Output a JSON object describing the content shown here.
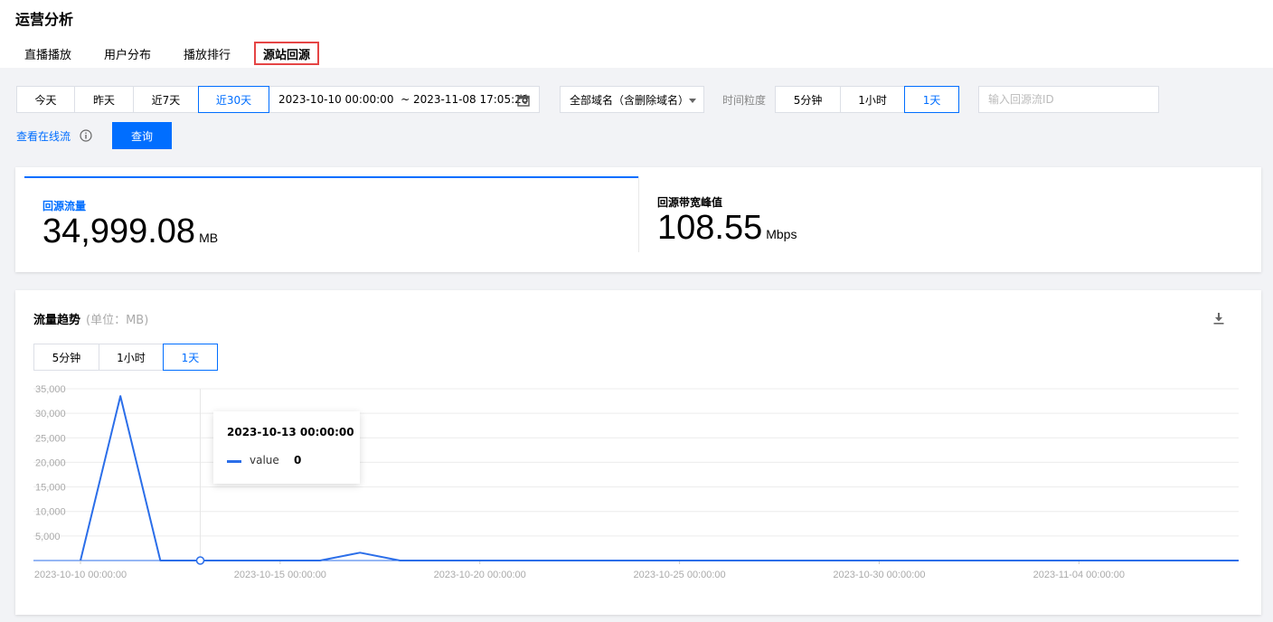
{
  "page": {
    "title": "运营分析",
    "tabs": [
      {
        "label": "直播播放"
      },
      {
        "label": "用户分布"
      },
      {
        "label": "播放排行"
      },
      {
        "label": "源站回源",
        "active": true
      }
    ]
  },
  "filters": {
    "date_presets": [
      {
        "label": "今天"
      },
      {
        "label": "昨天"
      },
      {
        "label": "近7天"
      },
      {
        "label": "近30天",
        "active": true
      }
    ],
    "date_range": "2023-10-10 00:00:00  ~ 2023-11-08 17:05:28",
    "domain_select": "全部域名（含删除域名）",
    "granularity_label": "时间粒度",
    "granularity": [
      {
        "label": "5分钟"
      },
      {
        "label": "1小时"
      },
      {
        "label": "1天",
        "active": true
      }
    ],
    "stream_id_placeholder": "输入回源流ID",
    "online_stream_link": "查看在线流",
    "query_button": "查询"
  },
  "stats": [
    {
      "label": "回源流量",
      "value": "34,999.08",
      "unit": "MB"
    },
    {
      "label": "回源带宽峰值",
      "value": "108.55",
      "unit": "Mbps"
    }
  ],
  "chart_panel": {
    "title": "流量趋势",
    "subtitle": "(单位：MB)",
    "granularity": [
      {
        "label": "5分钟"
      },
      {
        "label": "1小时"
      },
      {
        "label": "1天",
        "active": true
      }
    ],
    "tooltip": {
      "time": "2023-10-13 00:00:00",
      "series_name": "value",
      "value": "0"
    }
  },
  "colors": {
    "accent": "#006eff",
    "series": "#2b6ee9",
    "tab_highlight": "#e54545"
  },
  "chart_data": {
    "type": "line",
    "x": [
      "2023-10-10",
      "2023-10-11",
      "2023-10-12",
      "2023-10-13",
      "2023-10-14",
      "2023-10-15",
      "2023-10-16",
      "2023-10-17",
      "2023-10-18",
      "2023-10-19",
      "2023-10-20",
      "2023-10-21",
      "2023-10-22",
      "2023-10-23",
      "2023-10-24",
      "2023-10-25",
      "2023-10-26",
      "2023-10-27",
      "2023-10-28",
      "2023-10-29",
      "2023-10-30",
      "2023-10-31",
      "2023-11-01",
      "2023-11-02",
      "2023-11-03",
      "2023-11-04",
      "2023-11-05",
      "2023-11-06",
      "2023-11-07",
      "2023-11-08"
    ],
    "series": [
      {
        "name": "value",
        "values": [
          0,
          33500,
          0,
          0,
          0,
          0,
          0,
          1600,
          0,
          0,
          0,
          0,
          0,
          0,
          0,
          0,
          0,
          0,
          0,
          0,
          0,
          0,
          0,
          0,
          0,
          0,
          0,
          0,
          0,
          0
        ]
      }
    ],
    "x_tick_labels": [
      "2023-10-10 00:00:00",
      "2023-10-15 00:00:00",
      "2023-10-20 00:00:00",
      "2023-10-25 00:00:00",
      "2023-10-30 00:00:00",
      "2023-11-04 00:00:00"
    ],
    "y_ticks": [
      "5,000",
      "10,000",
      "15,000",
      "20,000",
      "25,000",
      "30,000",
      "35,000"
    ],
    "ylim": [
      0,
      35000
    ],
    "grid": true,
    "highlight_date": "2023-10-13"
  }
}
